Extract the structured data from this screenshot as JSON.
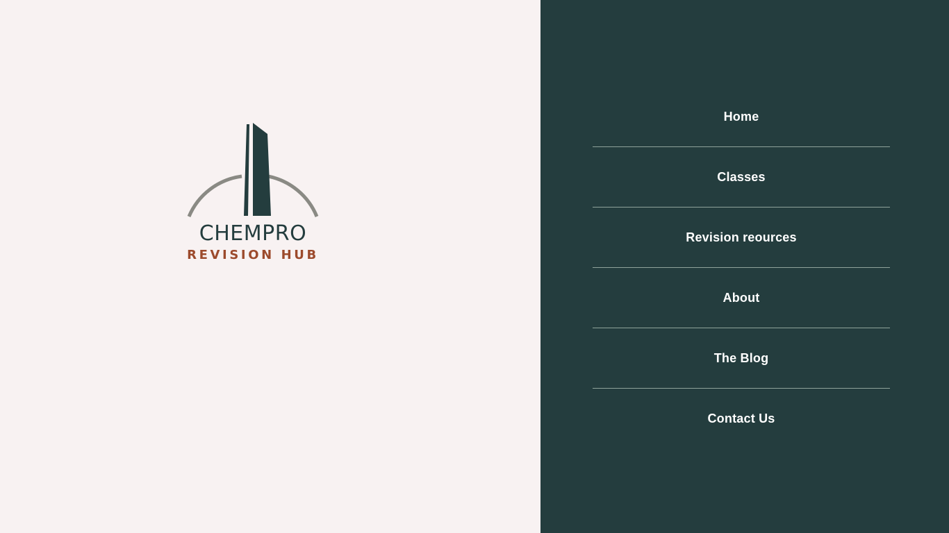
{
  "brand": {
    "title": "CHEMPRO",
    "subtitle": "REVISION HUB",
    "logo_icon": "tower-arch-logo",
    "colors": {
      "primary": "#243d3e",
      "accent": "#9c4a2c",
      "arch": "#8a8a84",
      "background": "#f8f2f2"
    }
  },
  "nav": {
    "items": [
      {
        "label": "Home"
      },
      {
        "label": "Classes"
      },
      {
        "label": "Revision reources"
      },
      {
        "label": "About"
      },
      {
        "label": "The Blog"
      },
      {
        "label": "Contact Us"
      }
    ]
  }
}
